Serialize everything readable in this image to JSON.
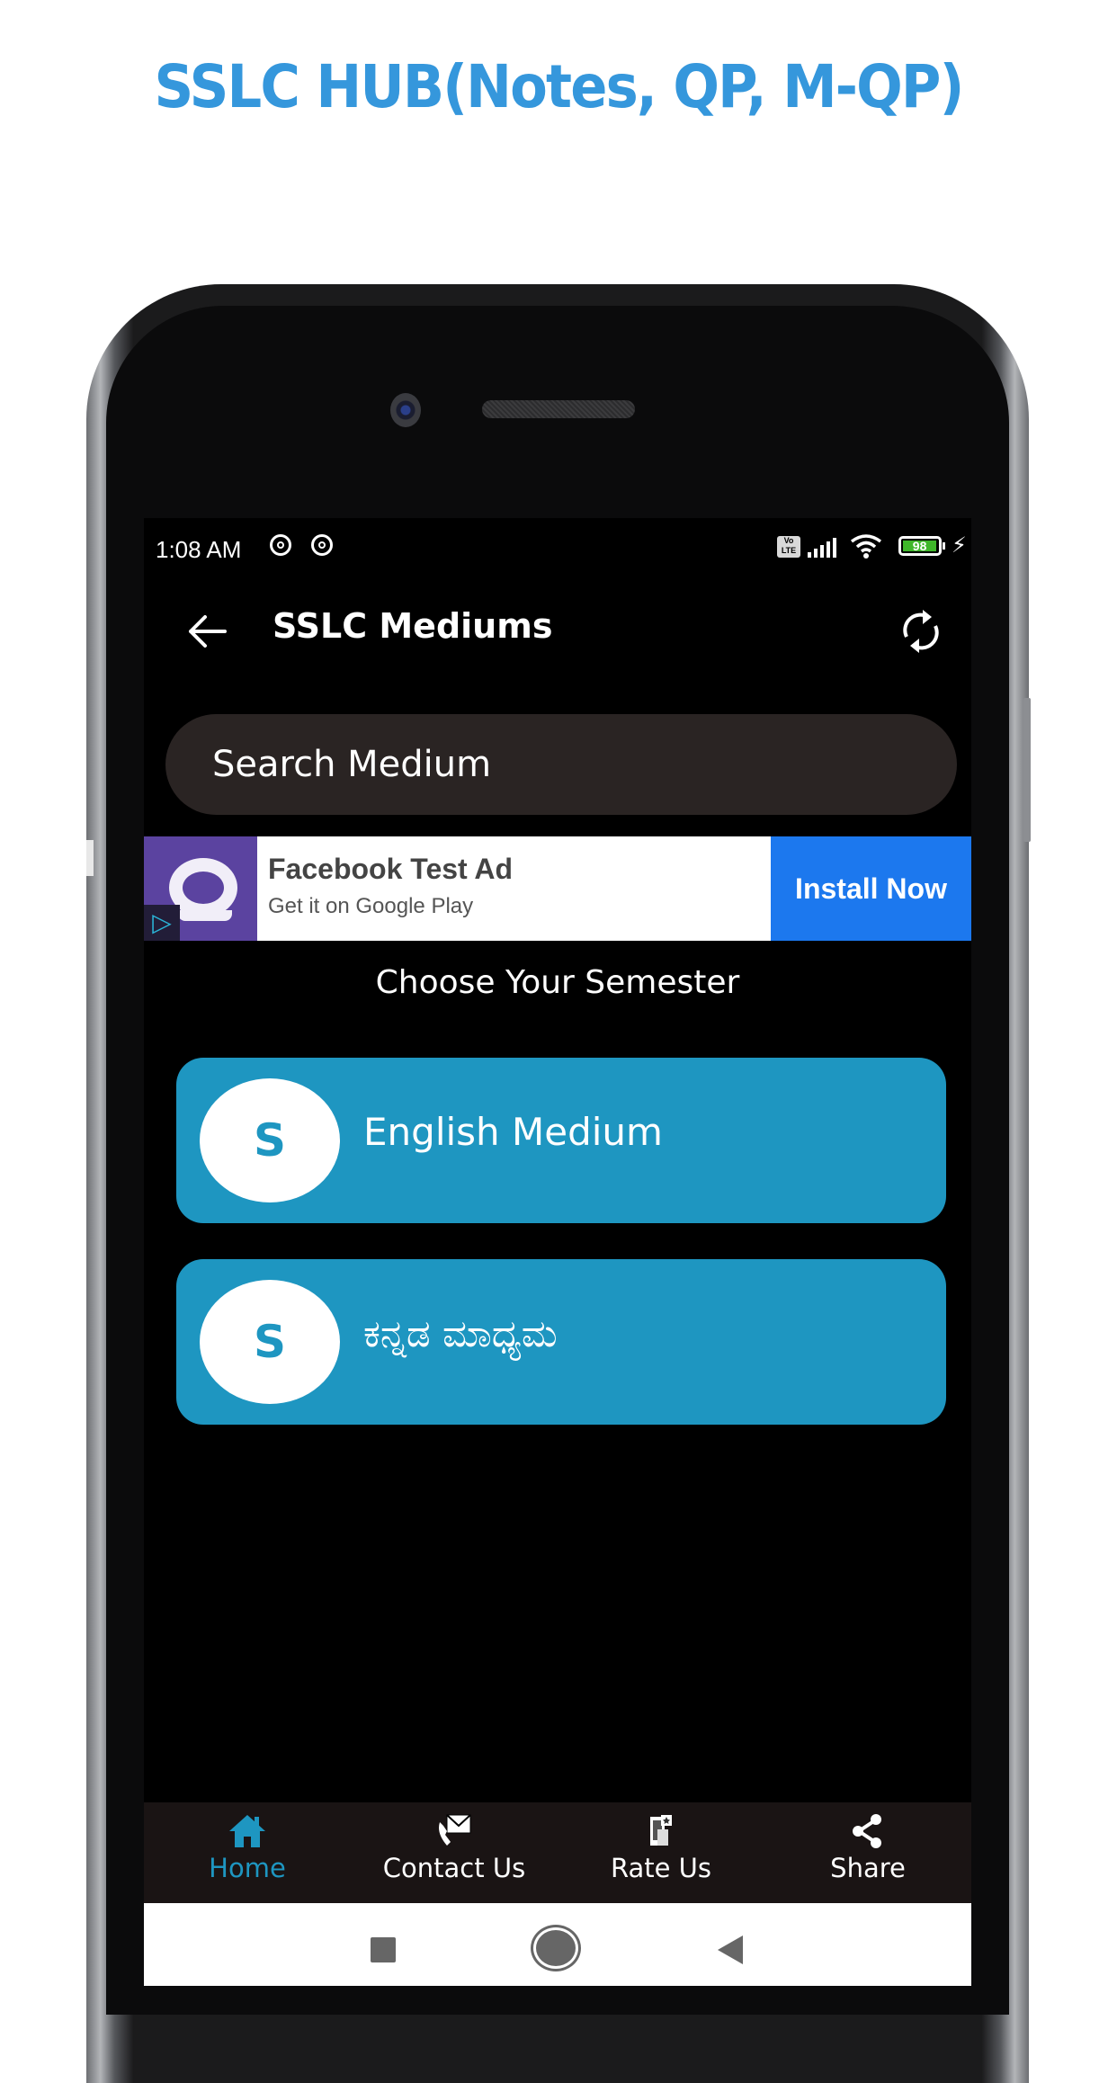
{
  "promo": {
    "title": "SSLC HUB(Notes, QP, M-QP)",
    "title_color": "#3597dc"
  },
  "status_bar": {
    "time": "1:08 AM",
    "notification_icons": [
      "app-notification-icon",
      "app-notification-icon"
    ],
    "network_badge": "Vo LTE",
    "battery_percent": 98,
    "charging": true
  },
  "app_bar": {
    "title": "SSLC Mediums",
    "back_icon": "arrow-left-icon",
    "refresh_icon": "refresh-icon"
  },
  "search": {
    "placeholder": "Search Medium",
    "value": ""
  },
  "ad": {
    "title": "Facebook Test Ad",
    "subtitle": "Get it on Google Play",
    "cta": "Install Now",
    "choices_icon": "i-triangle",
    "colors": {
      "icon_bg": "#5b43a0",
      "cta_bg": "#1c78ee"
    }
  },
  "section_heading": "Choose Your Semester",
  "mediums": [
    {
      "avatar_letter": "S",
      "label": "English Medium"
    },
    {
      "avatar_letter": "S",
      "label": "ಕನ್ನಡ ಮಾಧ್ಯಮ"
    }
  ],
  "accent_color": "#1e96c1",
  "bottom_nav": [
    {
      "label": "Home",
      "icon": "home-icon",
      "active": true
    },
    {
      "label": "Contact Us",
      "icon": "contact-mail-phone-icon",
      "active": false
    },
    {
      "label": "Rate Us",
      "icon": "rate-icon",
      "active": false
    },
    {
      "label": "Share",
      "icon": "share-icon",
      "active": false
    }
  ],
  "system_nav": [
    "recents",
    "home",
    "back"
  ]
}
